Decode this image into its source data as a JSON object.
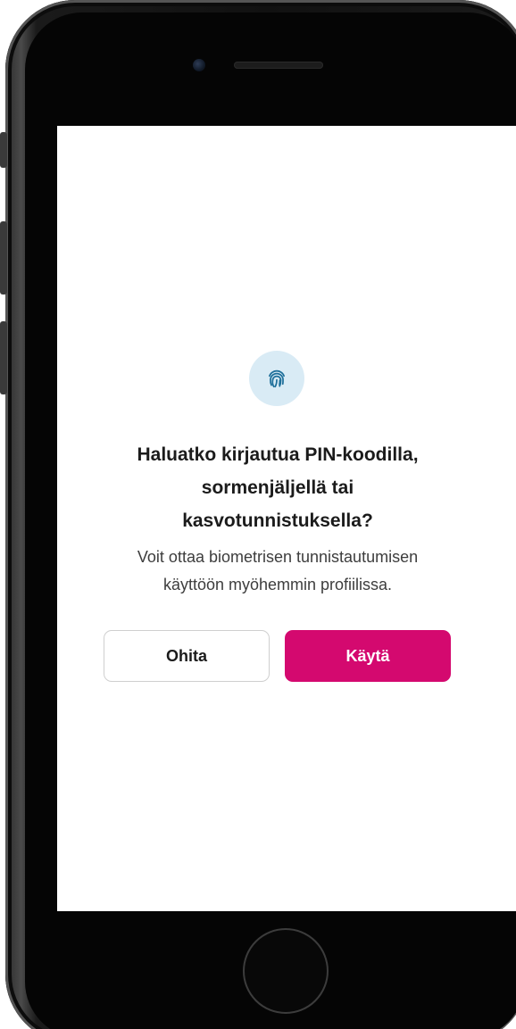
{
  "dialog": {
    "icon": "fingerprint-icon",
    "title_line1": "Haluatko kirjautua PIN-koodilla,",
    "title_line2": "sormenjäljellä tai",
    "title_line3": "kasvotunnistuksella?",
    "subtitle_line1": "Voit ottaa biometrisen tunnistautumisen",
    "subtitle_line2": "käyttöön myöhemmin profiilissa.",
    "skip_label": "Ohita",
    "use_label": "Käytä"
  },
  "colors": {
    "accent": "#d4096f",
    "icon_bg": "#d9ebf5",
    "icon_fg": "#1e6f9a"
  }
}
